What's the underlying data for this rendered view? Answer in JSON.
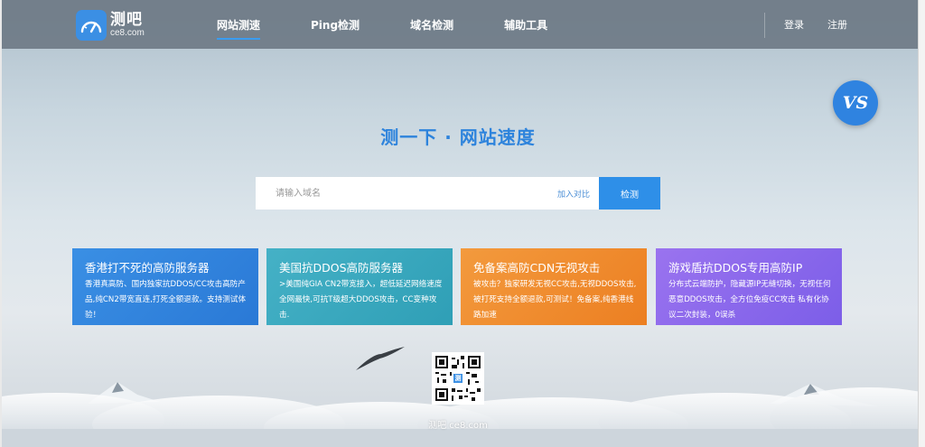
{
  "brand": {
    "title": "测吧",
    "subtitle": "ce8.com"
  },
  "nav": {
    "items": [
      {
        "label": "网站测速",
        "active": true
      },
      {
        "label": "Ping检测",
        "active": false
      },
      {
        "label": "域名检测",
        "active": false
      },
      {
        "label": "辅助工具",
        "active": false
      }
    ]
  },
  "auth": {
    "login": "登录",
    "register": "注册"
  },
  "vs_button": {
    "label": "VS"
  },
  "hero": {
    "title": "测一下 · 网站速度"
  },
  "search": {
    "placeholder": "请输入域名",
    "value": "",
    "compare_label": "加入对比",
    "submit_label": "检测"
  },
  "cards": [
    {
      "title": "香港打不死的高防服务器",
      "desc": "香港真高防、国内独家抗DDOS/CC攻击高防产品,纯CN2带宽直连,打死全额退款。支持测试体验！",
      "color": "#3a8fe4"
    },
    {
      "title": "美国抗DDOS高防服务器",
      "desc": ">美国纯GIA CN2带宽接入，超低延迟网络速度全网最快,可抗T级超大DDOS攻击，CC变种攻击.",
      "color": "#45b1c6"
    },
    {
      "title": "免备案高防CDN无视攻击",
      "desc": "被攻击？独家研发无视CC攻击,无视DDOS攻击,被打死支持全额退款,可测试！免备案,纯香港线路加速",
      "color": "#f08b2e"
    },
    {
      "title": "游戏盾抗DDOS专用高防IP",
      "desc": "分布式云端防护，隐藏源IP无缝切换，无视任何恶意DDOS攻击，全方位免疫CC攻击 私有化协议二次封装，0误杀",
      "color": "#8a68ec"
    }
  ],
  "footer": {
    "qr_caption": "测吧 ce8.com",
    "qr_center_label": "测"
  },
  "colors": {
    "header_bg": "#6e7a86",
    "accent": "#2e8fe8",
    "hero_title": "#2d83dc"
  }
}
